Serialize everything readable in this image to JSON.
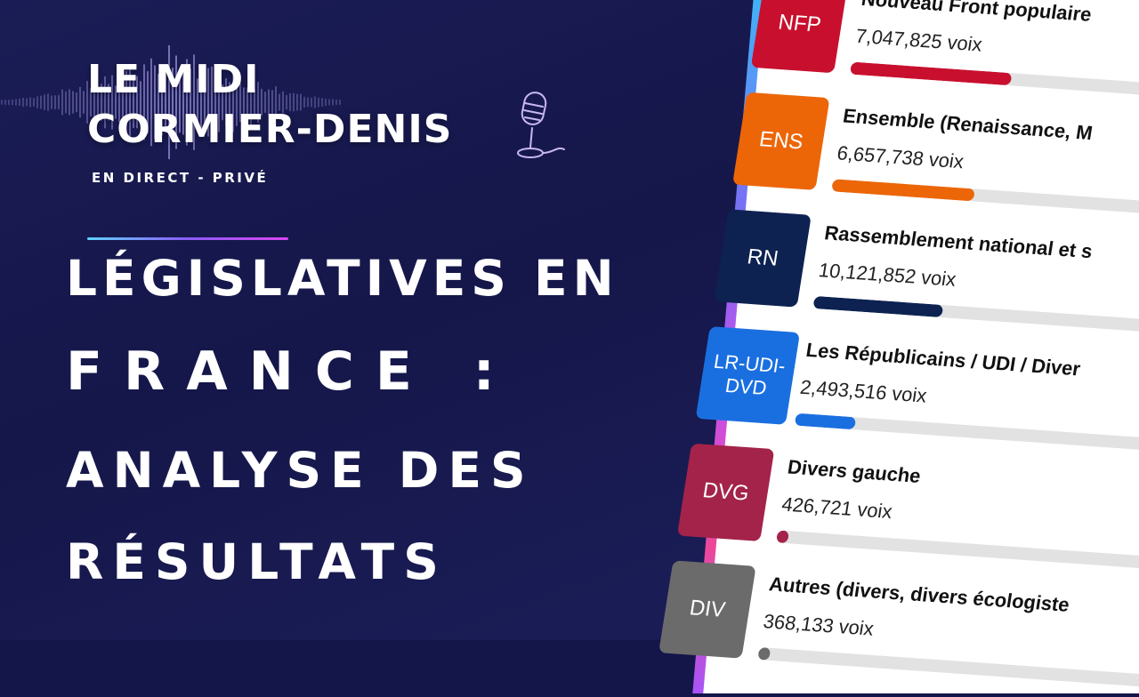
{
  "show": {
    "title_line1": "LE MIDI",
    "title_line2": "CORMIER-DENIS",
    "subtitle": "EN DIRECT - PRIVÉ"
  },
  "headline": {
    "line1": "LÉGISLATIVES EN",
    "line2": "FRANCE :",
    "line3": "ANALYSE DES",
    "line4": "RÉSULTATS"
  },
  "results": [
    {
      "code": "NFP",
      "name": "Nouveau Front populaire",
      "votes": "7,047,825 voix",
      "color": "#c8102e",
      "share": 0.35
    },
    {
      "code": "ENS",
      "name": "Ensemble (Renaissance, M",
      "votes": "6,657,738 voix",
      "color": "#ec6607",
      "share": 0.31
    },
    {
      "code": "RN",
      "name": "Rassemblement national et s",
      "votes": "10,121,852 voix",
      "color": "#0d2251",
      "share": 0.28
    },
    {
      "code": "LR-UDI-DVD",
      "name": "Les Républicains / UDI / Diver",
      "votes": "2,493,516 voix",
      "color": "#1a6fe0",
      "share": 0.13
    },
    {
      "code": "DVG",
      "name": "Divers gauche",
      "votes": "426,721 voix",
      "color": "#a3234a",
      "share": 0.025
    },
    {
      "code": "DIV",
      "name": "Autres (divers, divers écologiste",
      "votes": "368,133 voix",
      "color": "#6b6b6b",
      "share": 0.02
    }
  ],
  "colors": {
    "background": "#15174a",
    "accent_gradient": [
      "#38bdf8",
      "#8b5cf6",
      "#ec4899"
    ]
  }
}
